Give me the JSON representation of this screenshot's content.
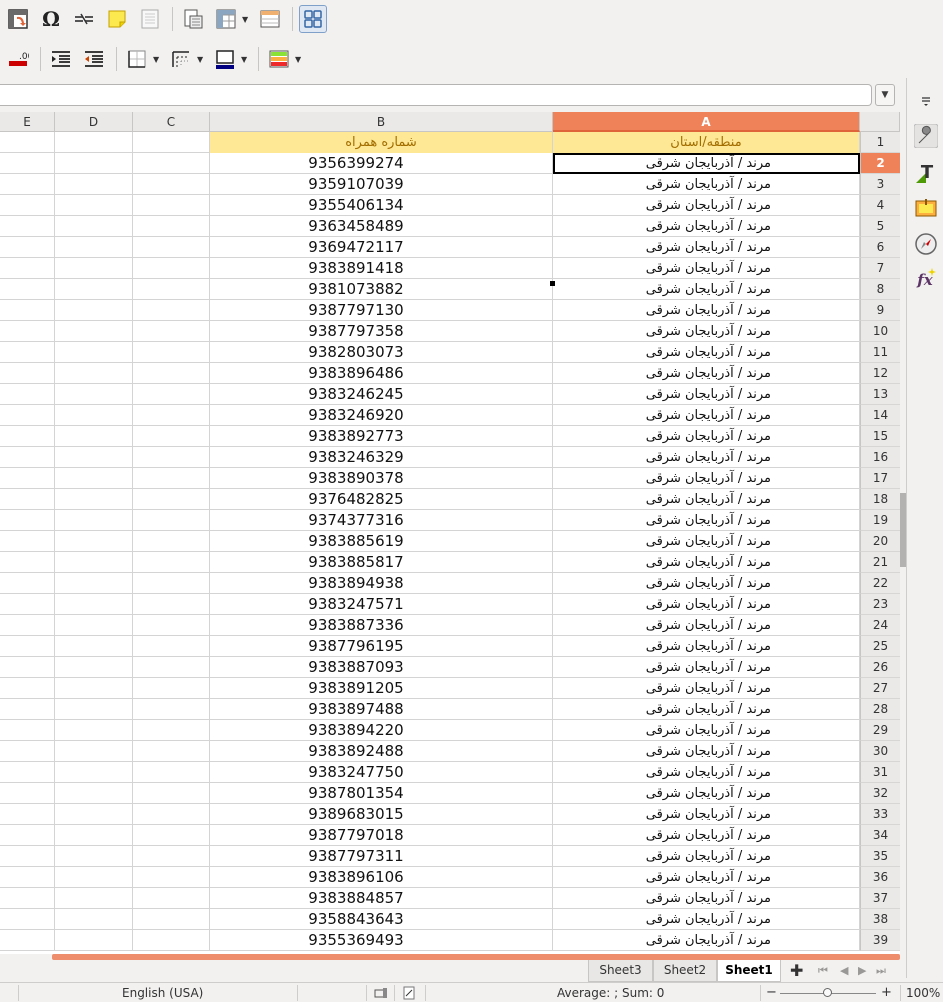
{
  "toolbar1": {
    "items": [
      "pivot-table",
      "special-character",
      "hyperlink",
      "comment",
      "header-footer",
      "print-area",
      "freeze-rows-columns",
      "column-header",
      "more-options"
    ]
  },
  "toolbar2": {
    "items": [
      "delete-decimal-place",
      "increase-indent",
      "decrease-indent",
      "borders",
      "border-style",
      "border-color",
      "conditional-formatting"
    ]
  },
  "columns": [
    "E",
    "D",
    "C",
    "B",
    "A"
  ],
  "active_column": "A",
  "active_row": "2",
  "header_row": {
    "row": "1",
    "A": "منطقه/استان",
    "B": "شماره همراه"
  },
  "rows": [
    {
      "n": "2",
      "A": "مرند / آذربایجان شرقی",
      "B": "9356399274"
    },
    {
      "n": "3",
      "A": "مرند / آذربایجان شرقی",
      "B": "9359107039"
    },
    {
      "n": "4",
      "A": "مرند / آذربایجان شرقی",
      "B": "9355406134"
    },
    {
      "n": "5",
      "A": "مرند / آذربایجان شرقی",
      "B": "9363458489"
    },
    {
      "n": "6",
      "A": "مرند / آذربایجان شرقی",
      "B": "9369472117"
    },
    {
      "n": "7",
      "A": "مرند / آذربایجان شرقی",
      "B": "9383891418"
    },
    {
      "n": "8",
      "A": "مرند / آذربایجان شرقی",
      "B": "9381073882"
    },
    {
      "n": "9",
      "A": "مرند / آذربایجان شرقی",
      "B": "9387797130"
    },
    {
      "n": "10",
      "A": "مرند / آذربایجان شرقی",
      "B": "9387797358"
    },
    {
      "n": "11",
      "A": "مرند / آذربایجان شرقی",
      "B": "9382803073"
    },
    {
      "n": "12",
      "A": "مرند / آذربایجان شرقی",
      "B": "9383896486"
    },
    {
      "n": "13",
      "A": "مرند / آذربایجان شرقی",
      "B": "9383246245"
    },
    {
      "n": "14",
      "A": "مرند / آذربایجان شرقی",
      "B": "9383246920"
    },
    {
      "n": "15",
      "A": "مرند / آذربایجان شرقی",
      "B": "9383892773"
    },
    {
      "n": "16",
      "A": "مرند / آذربایجان شرقی",
      "B": "9383246329"
    },
    {
      "n": "17",
      "A": "مرند / آذربایجان شرقی",
      "B": "9383890378"
    },
    {
      "n": "18",
      "A": "مرند / آذربایجان شرقی",
      "B": "9376482825"
    },
    {
      "n": "19",
      "A": "مرند / آذربایجان شرقی",
      "B": "9374377316"
    },
    {
      "n": "20",
      "A": "مرند / آذربایجان شرقی",
      "B": "9383885619"
    },
    {
      "n": "21",
      "A": "مرند / آذربایجان شرقی",
      "B": "9383885817"
    },
    {
      "n": "22",
      "A": "مرند / آذربایجان شرقی",
      "B": "9383894938"
    },
    {
      "n": "23",
      "A": "مرند / آذربایجان شرقی",
      "B": "9383247571"
    },
    {
      "n": "24",
      "A": "مرند / آذربایجان شرقی",
      "B": "9383887336"
    },
    {
      "n": "25",
      "A": "مرند / آذربایجان شرقی",
      "B": "9387796195"
    },
    {
      "n": "26",
      "A": "مرند / آذربایجان شرقی",
      "B": "9383887093"
    },
    {
      "n": "27",
      "A": "مرند / آذربایجان شرقی",
      "B": "9383891205"
    },
    {
      "n": "28",
      "A": "مرند / آذربایجان شرقی",
      "B": "9383897488"
    },
    {
      "n": "29",
      "A": "مرند / آذربایجان شرقی",
      "B": "9383894220"
    },
    {
      "n": "30",
      "A": "مرند / آذربایجان شرقی",
      "B": "9383892488"
    },
    {
      "n": "31",
      "A": "مرند / آذربایجان شرقی",
      "B": "9383247750"
    },
    {
      "n": "32",
      "A": "مرند / آذربایجان شرقی",
      "B": "9387801354"
    },
    {
      "n": "33",
      "A": "مرند / آذربایجان شرقی",
      "B": "9389683015"
    },
    {
      "n": "34",
      "A": "مرند / آذربایجان شرقی",
      "B": "9387797018"
    },
    {
      "n": "35",
      "A": "مرند / آذربایجان شرقی",
      "B": "9387797311"
    },
    {
      "n": "36",
      "A": "مرند / آذربایجان شرقی",
      "B": "9383896106"
    },
    {
      "n": "37",
      "A": "مرند / آذربایجان شرقی",
      "B": "9383884857"
    },
    {
      "n": "38",
      "A": "مرند / آذربایجان شرقی",
      "B": "9358843643"
    },
    {
      "n": "39",
      "A": "مرند / آذربایجان شرقی",
      "B": "9355369493"
    }
  ],
  "sheet_tabs": [
    {
      "label": "Sheet3",
      "active": false
    },
    {
      "label": "Sheet2",
      "active": false
    },
    {
      "label": "Sheet1",
      "active": true
    }
  ],
  "statusbar": {
    "language": "English (USA)",
    "selection_summary": "Average: ; Sum: 0",
    "zoom_minus": "−",
    "zoom_plus": "+",
    "zoom_level": "100%"
  },
  "colors": {
    "accent": "#f0825a",
    "header_fill": "#fee795",
    "header_text": "#a36e00"
  }
}
